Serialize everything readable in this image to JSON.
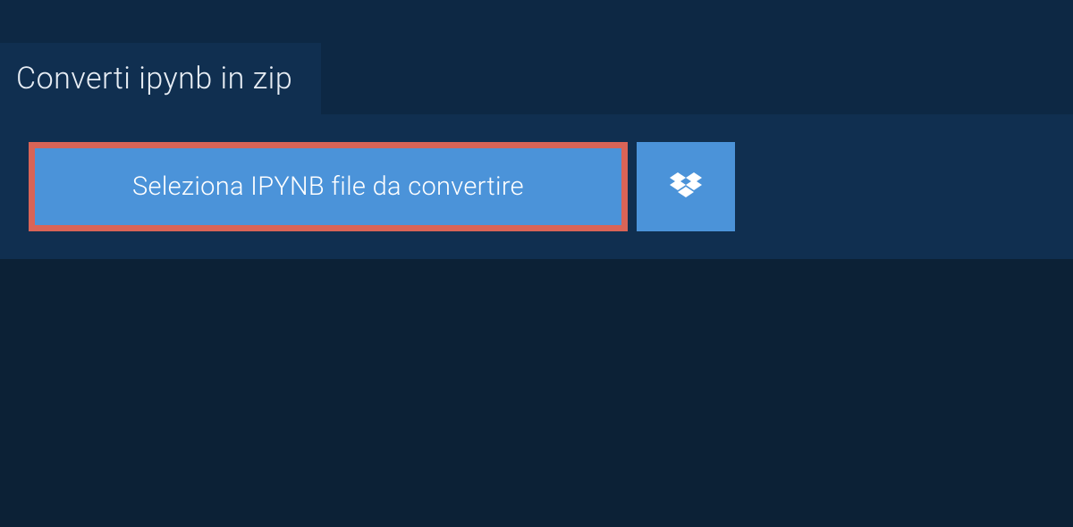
{
  "tab": {
    "title": "Converti ipynb in zip"
  },
  "actions": {
    "select_file_label": "Seleziona IPYNB file da convertire"
  },
  "colors": {
    "background": "#0d2844",
    "panel": "#102f50",
    "button": "#4b93d9",
    "highlight_border": "#d96457",
    "bottom": "#0c2136"
  }
}
